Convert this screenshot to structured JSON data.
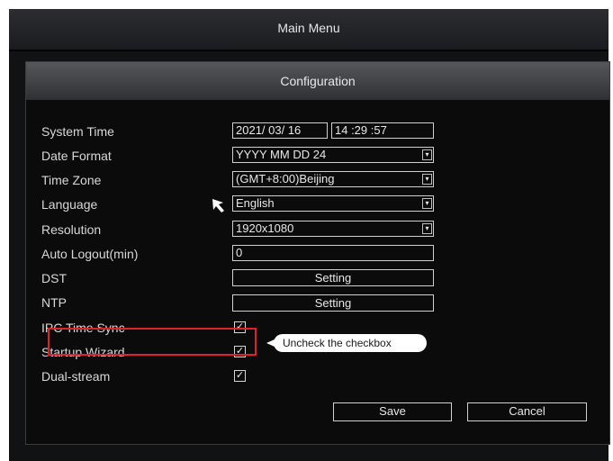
{
  "main_menu": {
    "title": "Main Menu"
  },
  "config": {
    "title": "Configuration",
    "rows": {
      "system_time": {
        "label": "System Time",
        "date": "2021/ 03/ 16",
        "time": "14 :29 :57"
      },
      "date_format": {
        "label": "Date Format",
        "value": "YYYY MM DD 24"
      },
      "time_zone": {
        "label": "Time Zone",
        "value": "(GMT+8:00)Beijing"
      },
      "language": {
        "label": "Language",
        "value": "English"
      },
      "resolution": {
        "label": "Resolution",
        "value": "1920x1080"
      },
      "auto_logout": {
        "label": "Auto Logout(min)",
        "value": "0"
      },
      "dst": {
        "label": "DST",
        "button": "Setting"
      },
      "ntp": {
        "label": "NTP",
        "button": "Setting"
      },
      "ipc_time_sync": {
        "label": "IPC Time Sync",
        "checked": true
      },
      "startup_wizard": {
        "label": "Startup Wizard",
        "checked": true
      },
      "dual_stream": {
        "label": "Dual-stream",
        "checked": true
      }
    },
    "buttons": {
      "save": "Save",
      "cancel": "Cancel"
    },
    "dropdown_arrow": "▾",
    "check_glyph": "✓"
  },
  "annotation": {
    "callout_text": "Uncheck the checkbox",
    "highlight_color": "#e0202a"
  }
}
